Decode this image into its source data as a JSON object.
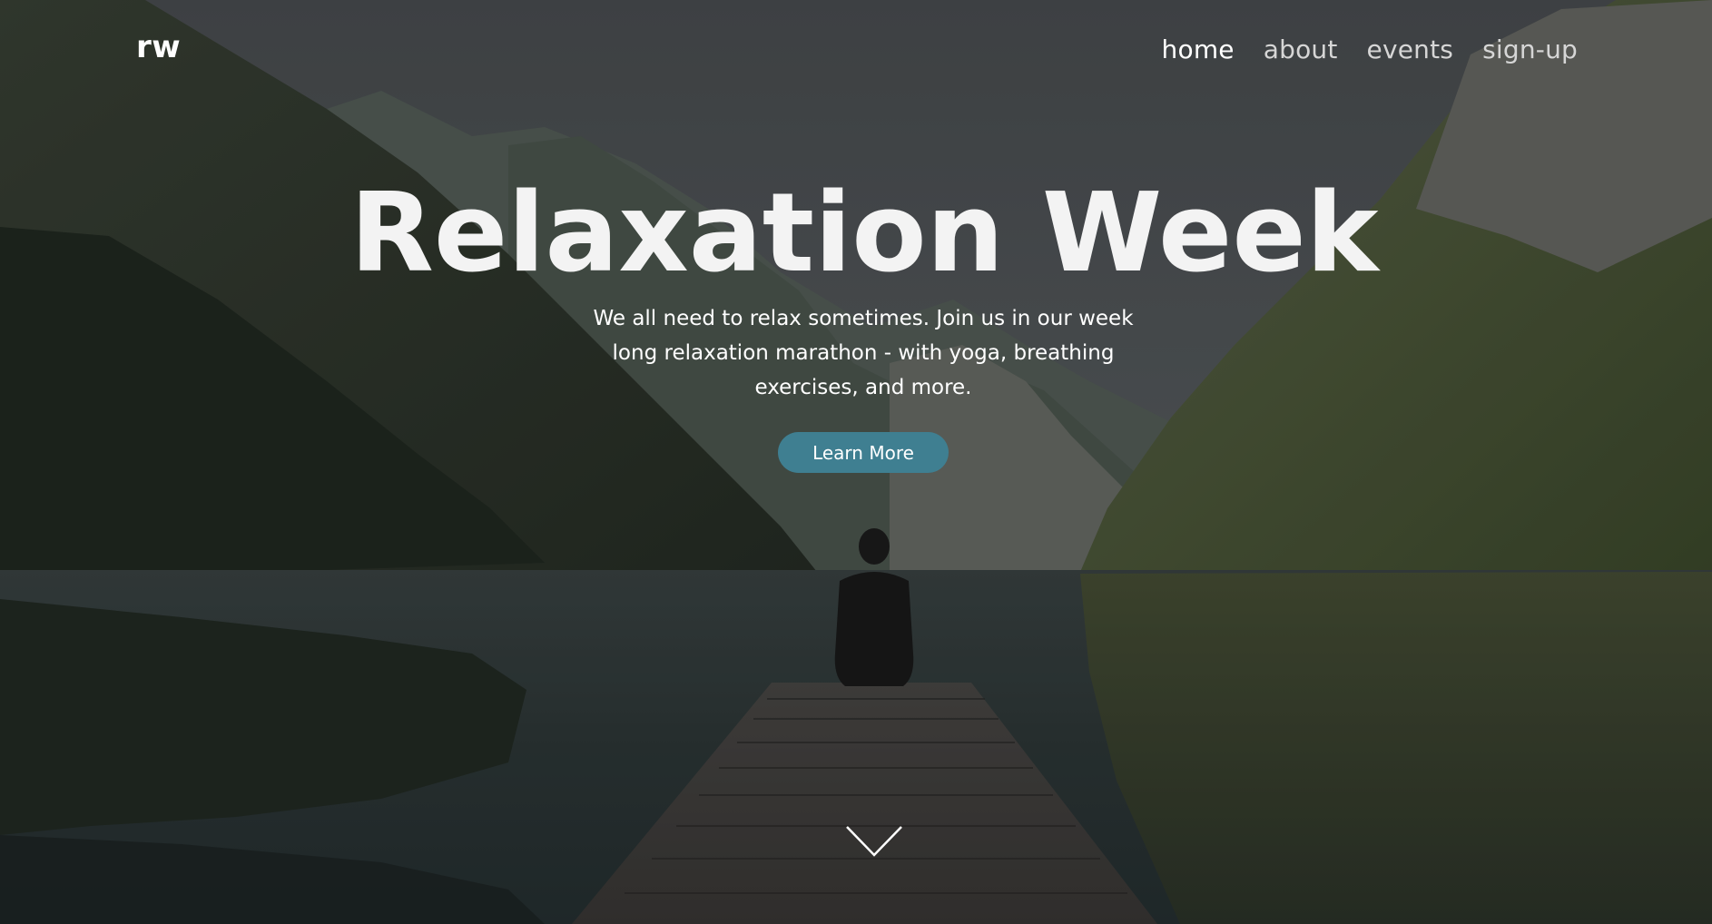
{
  "logo": "rw",
  "nav": {
    "items": [
      {
        "label": "home",
        "active": true
      },
      {
        "label": "about",
        "active": false
      },
      {
        "label": "events",
        "active": false
      },
      {
        "label": "sign-up",
        "active": false
      }
    ]
  },
  "hero": {
    "title": "Relaxation Week",
    "description": "We all need to relax sometimes. Join us in our week long relaxation marathon - with yoga, breathing exercises, and more.",
    "button_label": "Learn More",
    "scroll_icon": "chevron-down-icon"
  },
  "colors": {
    "accent": "#3f7f91",
    "text": "#ffffff",
    "nav_inactive": "#d6d6d6"
  }
}
